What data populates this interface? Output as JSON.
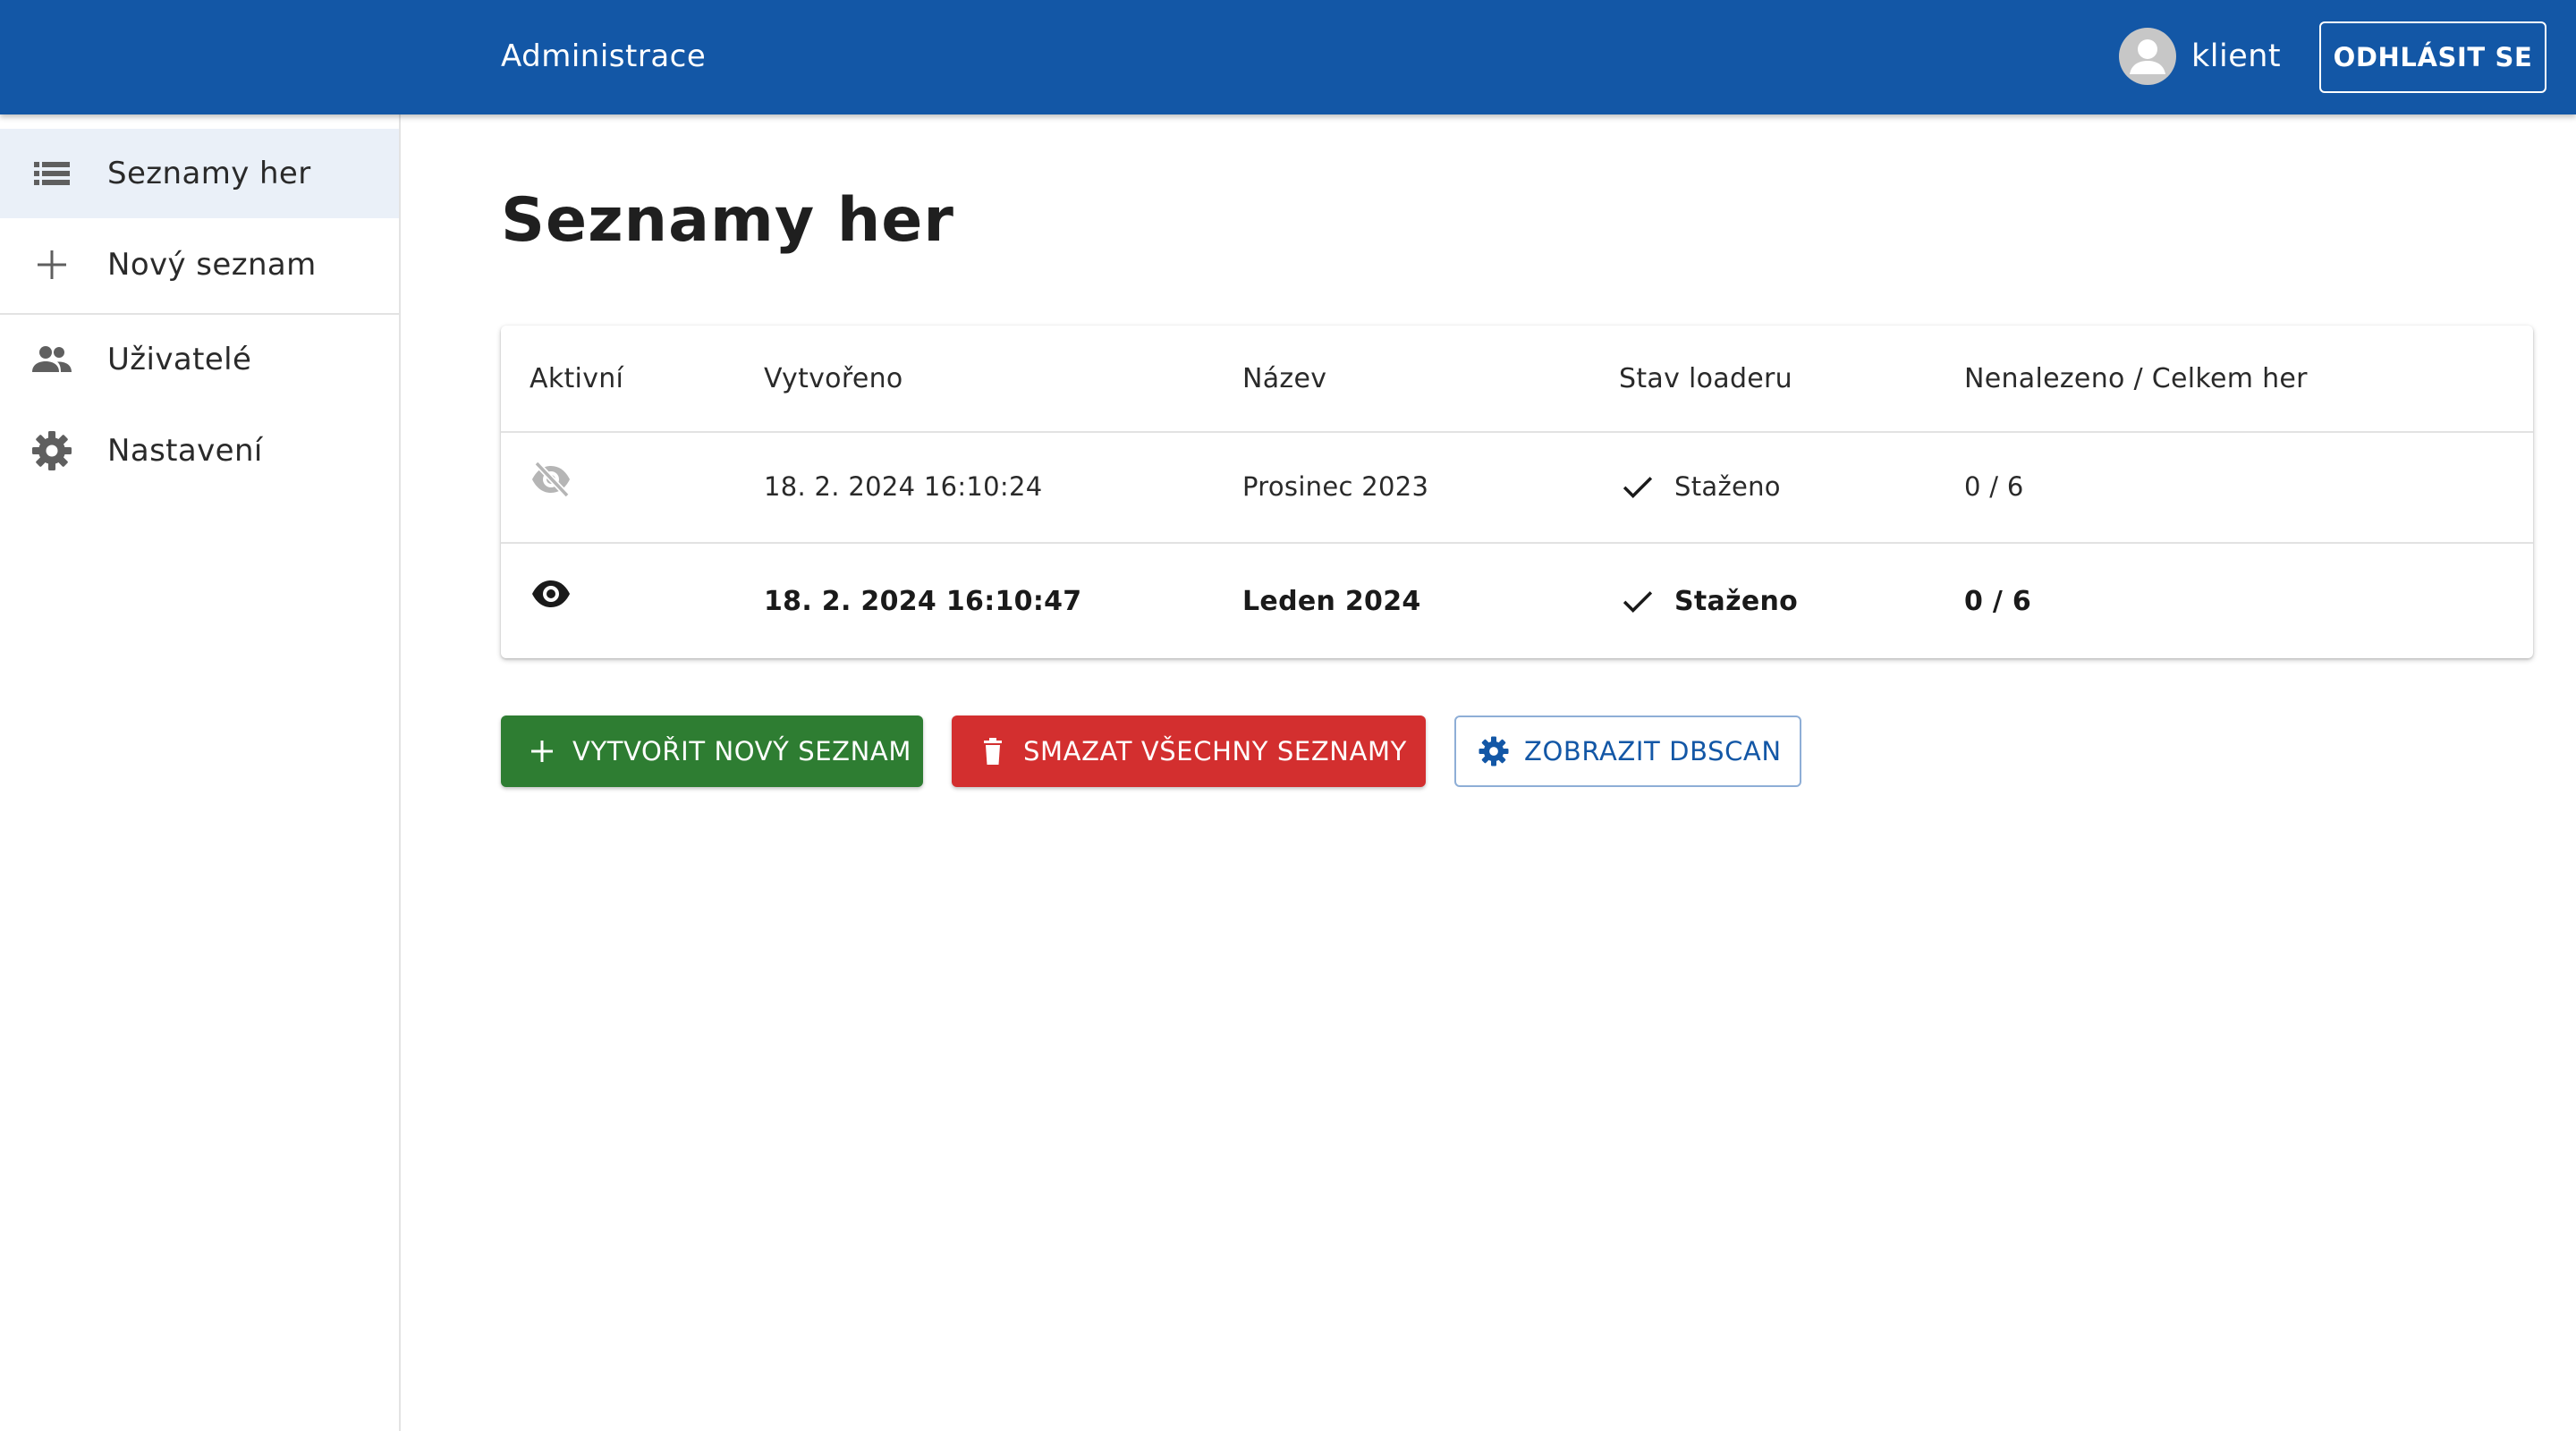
{
  "appbar": {
    "title": "Administrace",
    "user_name": "klient",
    "logout_label": "ODHLÁSIT SE",
    "icons": {
      "avatar": "account-circle-icon"
    }
  },
  "sidebar": {
    "items": [
      {
        "label": "Seznamy her",
        "icon": "list-icon",
        "selected": true
      },
      {
        "label": "Nový seznam",
        "icon": "plus-icon",
        "selected": false
      },
      {
        "label": "Uživatelé",
        "icon": "people-icon",
        "selected": false
      },
      {
        "label": "Nastavení",
        "icon": "gear-icon",
        "selected": false
      }
    ]
  },
  "main": {
    "title": "Seznamy her",
    "table": {
      "headers": {
        "active": "Aktivní",
        "created": "Vytvořeno",
        "name": "Název",
        "state": "Stav loaderu",
        "count": "Nenalezeno / Celkem her"
      },
      "rows": [
        {
          "active": false,
          "active_icon": "eye-off-icon",
          "created": "18. 2. 2024 16:10:24",
          "name": "Prosinec 2023",
          "state": "Staženo",
          "state_icon": "check-icon",
          "count": "0 / 6"
        },
        {
          "active": true,
          "active_icon": "eye-icon",
          "created": "18. 2. 2024 16:10:47",
          "name": "Leden 2024",
          "state": "Staženo",
          "state_icon": "check-icon",
          "count": "0 / 6"
        }
      ]
    },
    "actions": {
      "create_label": "VYTVOŘIT NOVÝ SEZNAM",
      "delete_label": "SMAZAT VŠECHNY SEZNAMY",
      "dbscan_label": "ZOBRAZIT DBSCAN"
    }
  },
  "colors": {
    "appbar": "#1357a6",
    "selected_nav": "#eaf0f8",
    "create_button": "#2e7d32",
    "delete_button": "#d32f2f",
    "dbscan_text": "#1357a6",
    "inactive_icon": "#b5b5b5"
  }
}
